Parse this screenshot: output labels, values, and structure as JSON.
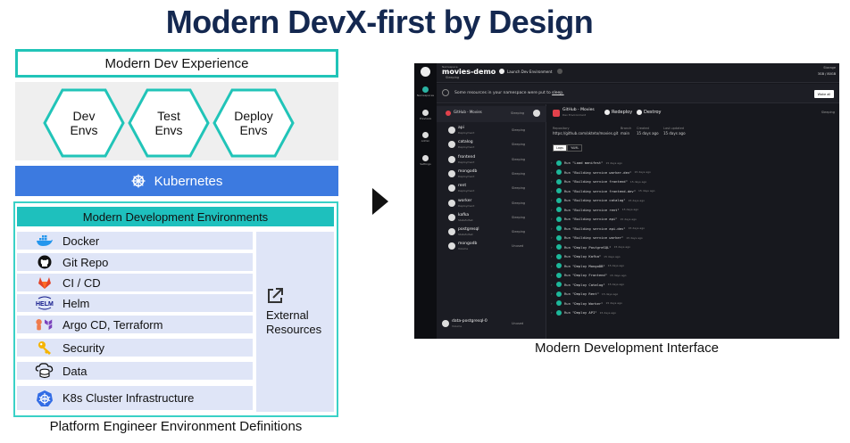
{
  "title": "Modern DevX-first by Design",
  "left": {
    "dev_experience": "Modern Dev Experience",
    "hexagons": [
      "Dev\nEnvs",
      "Test\nEnvs",
      "Deploy\nEnvs"
    ],
    "kubernetes": "Kubernetes",
    "environments_header": "Modern Development Environments",
    "tools": [
      {
        "label": "Docker",
        "icon": "docker-icon",
        "color": "#2496ed"
      },
      {
        "label": "Git Repo",
        "icon": "github-icon",
        "color": "#111111"
      },
      {
        "label": "CI / CD",
        "icon": "gitlab-icon",
        "color": "#e24329"
      },
      {
        "label": "Helm",
        "icon": "helm-icon",
        "color": "#0f1689"
      },
      {
        "label": "Argo CD, Terraform",
        "icon": "argo-terraform-icon",
        "color": "#7b42bc"
      },
      {
        "label": "Security",
        "icon": "key-icon",
        "color": "#f5b400"
      },
      {
        "label": "Data",
        "icon": "database-cloud-icon",
        "color": "#111111"
      },
      {
        "label": "K8s Cluster Infrastructure",
        "icon": "kubernetes-icon",
        "color": "#326ce5"
      }
    ],
    "external_resources": "External\nResources",
    "caption": "Platform Engineer Environment Definitions"
  },
  "right": {
    "caption": "Modern Development Interface",
    "app": {
      "sidebar": [
        {
          "label": "Namespaces",
          "icon": "namespaces-icon"
        },
        {
          "label": "Previews",
          "icon": "previews-icon"
        },
        {
          "label": "Admin",
          "icon": "admin-icon"
        },
        {
          "label": "Settings",
          "icon": "settings-icon"
        }
      ],
      "namespace_label": "Namespace",
      "namespace": "movies-demo",
      "namespace_status": "Sleeping",
      "launch": "Launch Dev Environment",
      "storage_label": "Storage",
      "storage_value": "3GB / 80GB",
      "banner_text": "Some resources in your namespace were put to ",
      "banner_link": "sleep.",
      "wake_all": "Wake all",
      "group": {
        "name": "GitHub - Movies",
        "status": "Sleeping"
      },
      "services": [
        {
          "name": "api",
          "kind": "Deployment",
          "status": "Sleeping"
        },
        {
          "name": "catalog",
          "kind": "Deployment",
          "status": "Sleeping"
        },
        {
          "name": "frontend",
          "kind": "Deployment",
          "status": "Sleeping"
        },
        {
          "name": "mongodb",
          "kind": "Deployment",
          "status": "Sleeping"
        },
        {
          "name": "rent",
          "kind": "Deployment",
          "status": "Sleeping"
        },
        {
          "name": "worker",
          "kind": "Deployment",
          "status": "Sleeping"
        },
        {
          "name": "kafka",
          "kind": "StatefulSet",
          "status": "Sleeping"
        },
        {
          "name": "postgresql",
          "kind": "StatefulSet",
          "status": "Sleeping"
        },
        {
          "name": "mongodb",
          "kind": "Volume",
          "status": "Unused"
        },
        {
          "name": "data-postgresql-0",
          "kind": "Volume",
          "status": "Unused"
        }
      ],
      "detail": {
        "name": "GitHub - Movies",
        "kind": "Dev Environment",
        "redeploy": "Redeploy",
        "destroy": "Destroy",
        "status": "Sleeping",
        "repository_label": "Repository",
        "repository": "https://github.com/okteto/movies.git",
        "branch_label": "Branch",
        "branch": "main",
        "created_label": "Created",
        "created": "15 days ago",
        "updated_label": "Last updated",
        "updated": "15 days ago",
        "tabs": [
          "Logs",
          "YAML"
        ],
        "logs": [
          "Run \"Load manifest\"",
          "Run \"Building service worker-dev\"",
          "Run \"Building service frontend\"",
          "Run \"Building service frontend-dev\"",
          "Run \"Building service catalog\"",
          "Run \"Building service rent\"",
          "Run \"Building service api\"",
          "Run \"Building service api-dev\"",
          "Run \"Building service worker\"",
          "Run \"Deploy PostgreSQL\"",
          "Run \"Deploy Kafka\"",
          "Run \"Deploy MongoDB\"",
          "Run \"Deploy Frontend\"",
          "Run \"Deploy Catalog\"",
          "Run \"Deploy Rent\"",
          "Run \"Deploy Worker\"",
          "Run \"Deploy API\""
        ],
        "log_age": "15 days ago"
      }
    }
  },
  "colors": {
    "title": "#142850",
    "teal": "#21c4b8",
    "kubernetes_blue": "#3c7ae0",
    "tool_bg": "#dfe5f7",
    "app_bg": "#16171d"
  }
}
